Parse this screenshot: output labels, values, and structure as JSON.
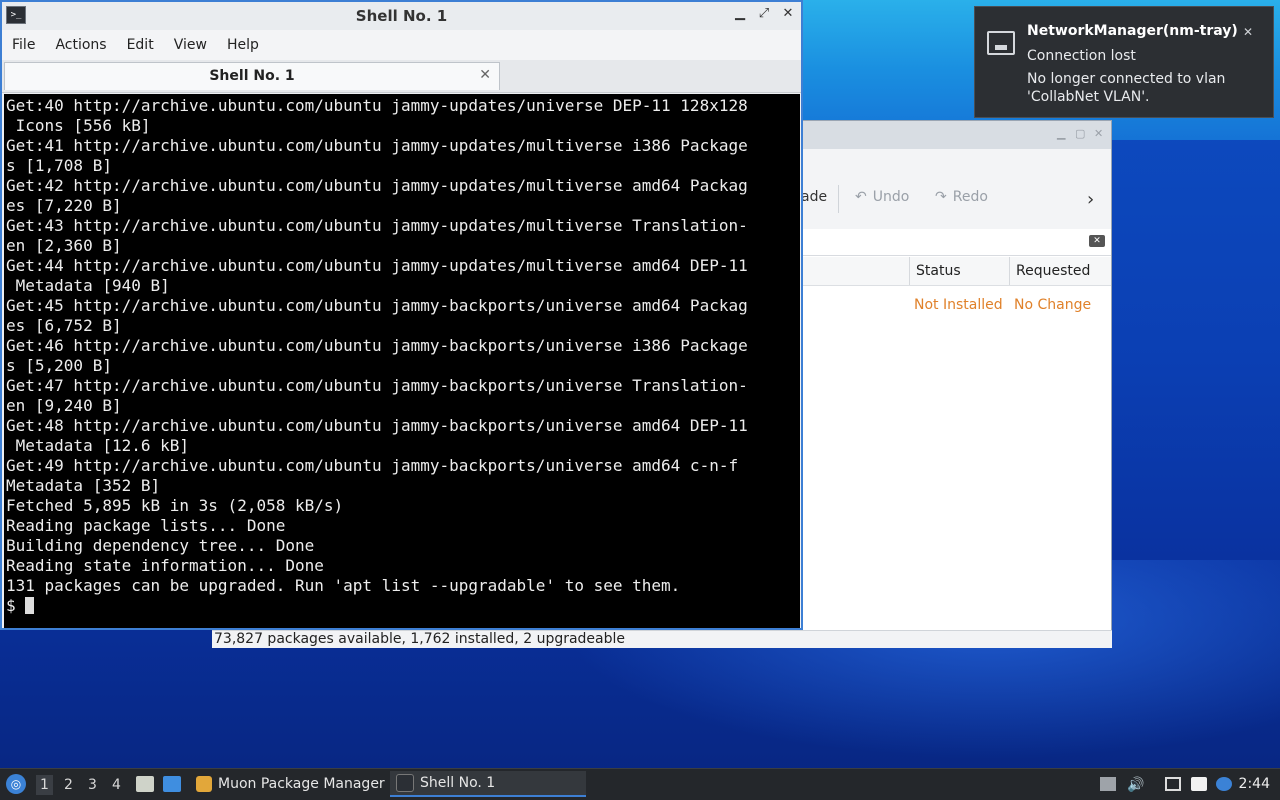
{
  "terminal": {
    "window_title": "Shell No. 1",
    "menu": [
      "File",
      "Actions",
      "Edit",
      "View",
      "Help"
    ],
    "tab_title": "Shell No. 1",
    "lines": [
      "Get:40 http://archive.ubuntu.com/ubuntu jammy-updates/universe DEP-11 128x128",
      " Icons [556 kB]",
      "Get:41 http://archive.ubuntu.com/ubuntu jammy-updates/multiverse i386 Package",
      "s [1,708 B]",
      "Get:42 http://archive.ubuntu.com/ubuntu jammy-updates/multiverse amd64 Packag",
      "es [7,220 B]",
      "Get:43 http://archive.ubuntu.com/ubuntu jammy-updates/multiverse Translation-",
      "en [2,360 B]",
      "Get:44 http://archive.ubuntu.com/ubuntu jammy-updates/multiverse amd64 DEP-11",
      " Metadata [940 B]",
      "Get:45 http://archive.ubuntu.com/ubuntu jammy-backports/universe amd64 Packag",
      "es [6,752 B]",
      "Get:46 http://archive.ubuntu.com/ubuntu jammy-backports/universe i386 Package",
      "s [5,200 B]",
      "Get:47 http://archive.ubuntu.com/ubuntu jammy-backports/universe Translation-",
      "en [9,240 B]",
      "Get:48 http://archive.ubuntu.com/ubuntu jammy-backports/universe amd64 DEP-11",
      " Metadata [12.6 kB]",
      "Get:49 http://archive.ubuntu.com/ubuntu jammy-backports/universe amd64 c-n-f",
      "Metadata [352 B]",
      "Fetched 5,895 kB in 3s (2,058 kB/s)",
      "Reading package lists... Done",
      "Building dependency tree... Done",
      "Reading state information... Done",
      "131 packages can be upgraded. Run 'apt list --upgradable' to see them."
    ],
    "prompt": "$ "
  },
  "muon": {
    "toolbar_partial": "ade",
    "undo_label": "Undo",
    "redo_label": "Redo",
    "columns": {
      "status": "Status",
      "requested": "Requested"
    },
    "row": {
      "status": "Not Installed",
      "requested": "No Change"
    },
    "status_bar": "73,827 packages available, 1,762 installed, 2 upgradeable"
  },
  "notification": {
    "title": "NetworkManager(nm-tray)",
    "line1": "Connection lost",
    "line2": "No longer connected to vlan",
    "line3": "'CollabNet VLAN'."
  },
  "taskbar": {
    "workspaces": [
      "1",
      "2",
      "3",
      "4"
    ],
    "tasks": [
      "Muon Package Manager",
      "Shell No. 1"
    ],
    "clock": "2:44"
  }
}
